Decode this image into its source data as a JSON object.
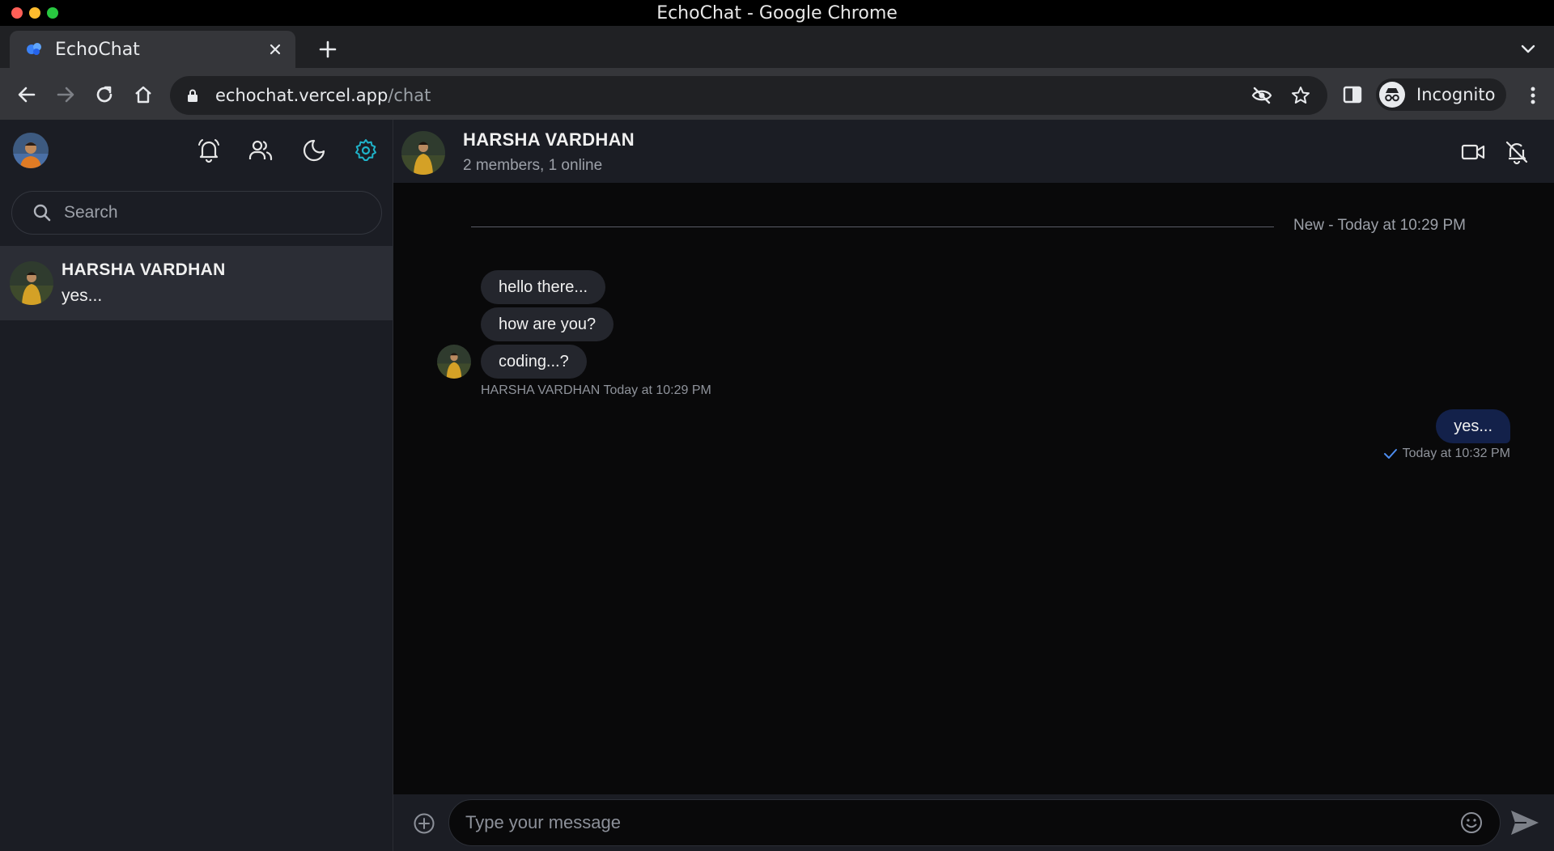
{
  "window": {
    "title": "EchoChat - Google Chrome"
  },
  "browser": {
    "tab_title": "EchoChat",
    "url_host": "echochat.vercel.app",
    "url_path": "/chat",
    "profile_label": "Incognito"
  },
  "sidebar": {
    "search_placeholder": "Search",
    "conversations": [
      {
        "name": "HARSHA VARDHAN",
        "last_message": "yes..."
      }
    ]
  },
  "chat": {
    "name": "HARSHA VARDHAN",
    "status": "2 members, 1 online",
    "divider": "New - Today at 10:29 PM",
    "incoming": {
      "messages": [
        "hello there...",
        "how are you?",
        "coding...?"
      ],
      "meta": "HARSHA VARDHAN Today at 10:29 PM"
    },
    "outgoing": {
      "message": "yes...",
      "meta": "Today at 10:32 PM"
    },
    "composer_placeholder": "Type your message"
  },
  "colors": {
    "accent": "#1fb3c9",
    "outgoing_bubble": "#13214a",
    "incoming_bubble": "#24262d",
    "sidebar_bg": "#1b1d24"
  },
  "icons": [
    "bell-icon",
    "users-icon",
    "moon-icon",
    "gear-icon",
    "search-icon",
    "video-icon",
    "bell-off-icon",
    "plus-circle-icon",
    "emoji-icon",
    "send-icon"
  ]
}
